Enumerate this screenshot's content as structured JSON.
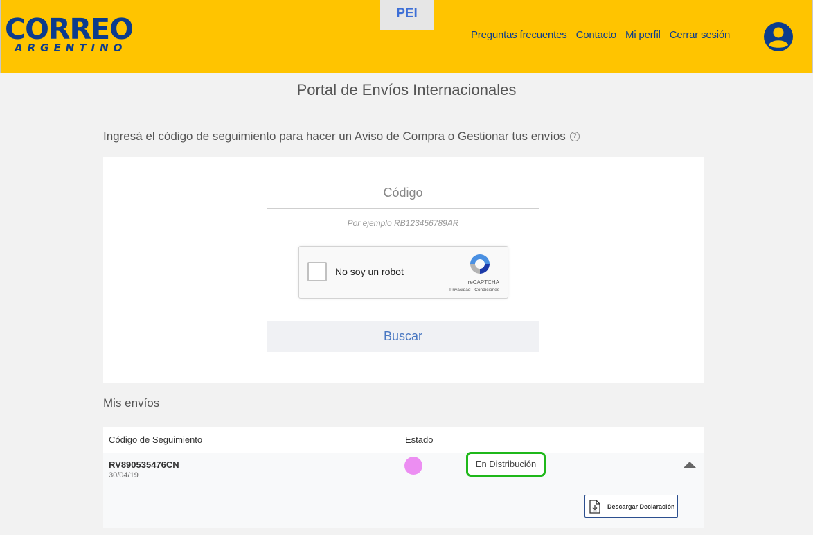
{
  "header": {
    "logo_main": "CORREO",
    "logo_sub": "ARGENTINO",
    "pei_label": "PEI",
    "nav": [
      "Preguntas frecuentes",
      "Contacto",
      "Mi perfil",
      "Cerrar sesión"
    ],
    "brand_color": "#ffc400",
    "logo_color": "#0c3c8c"
  },
  "main": {
    "title": "Portal de Envíos Internacionales",
    "instruction": "Ingresá el código de seguimiento para hacer un Aviso de Compra o Gestionar tus envíos",
    "help_icon": "?",
    "code_placeholder": "Código",
    "code_value": "",
    "code_example": "Por ejemplo RB123456789AR",
    "recaptcha": {
      "label": "No soy un robot",
      "brand": "reCAPTCHA",
      "terms": "Privacidad - Condiciones"
    },
    "search_label": "Buscar"
  },
  "shipments": {
    "title": "Mis envíos",
    "columns": [
      "Código de Seguimiento",
      "Estado"
    ],
    "rows": [
      {
        "code": "RV890535476CN",
        "date": "30/04/19",
        "status": "En Distribución",
        "status_color": "#ec8ef2",
        "download_label": "Descargar Declaración"
      }
    ]
  }
}
